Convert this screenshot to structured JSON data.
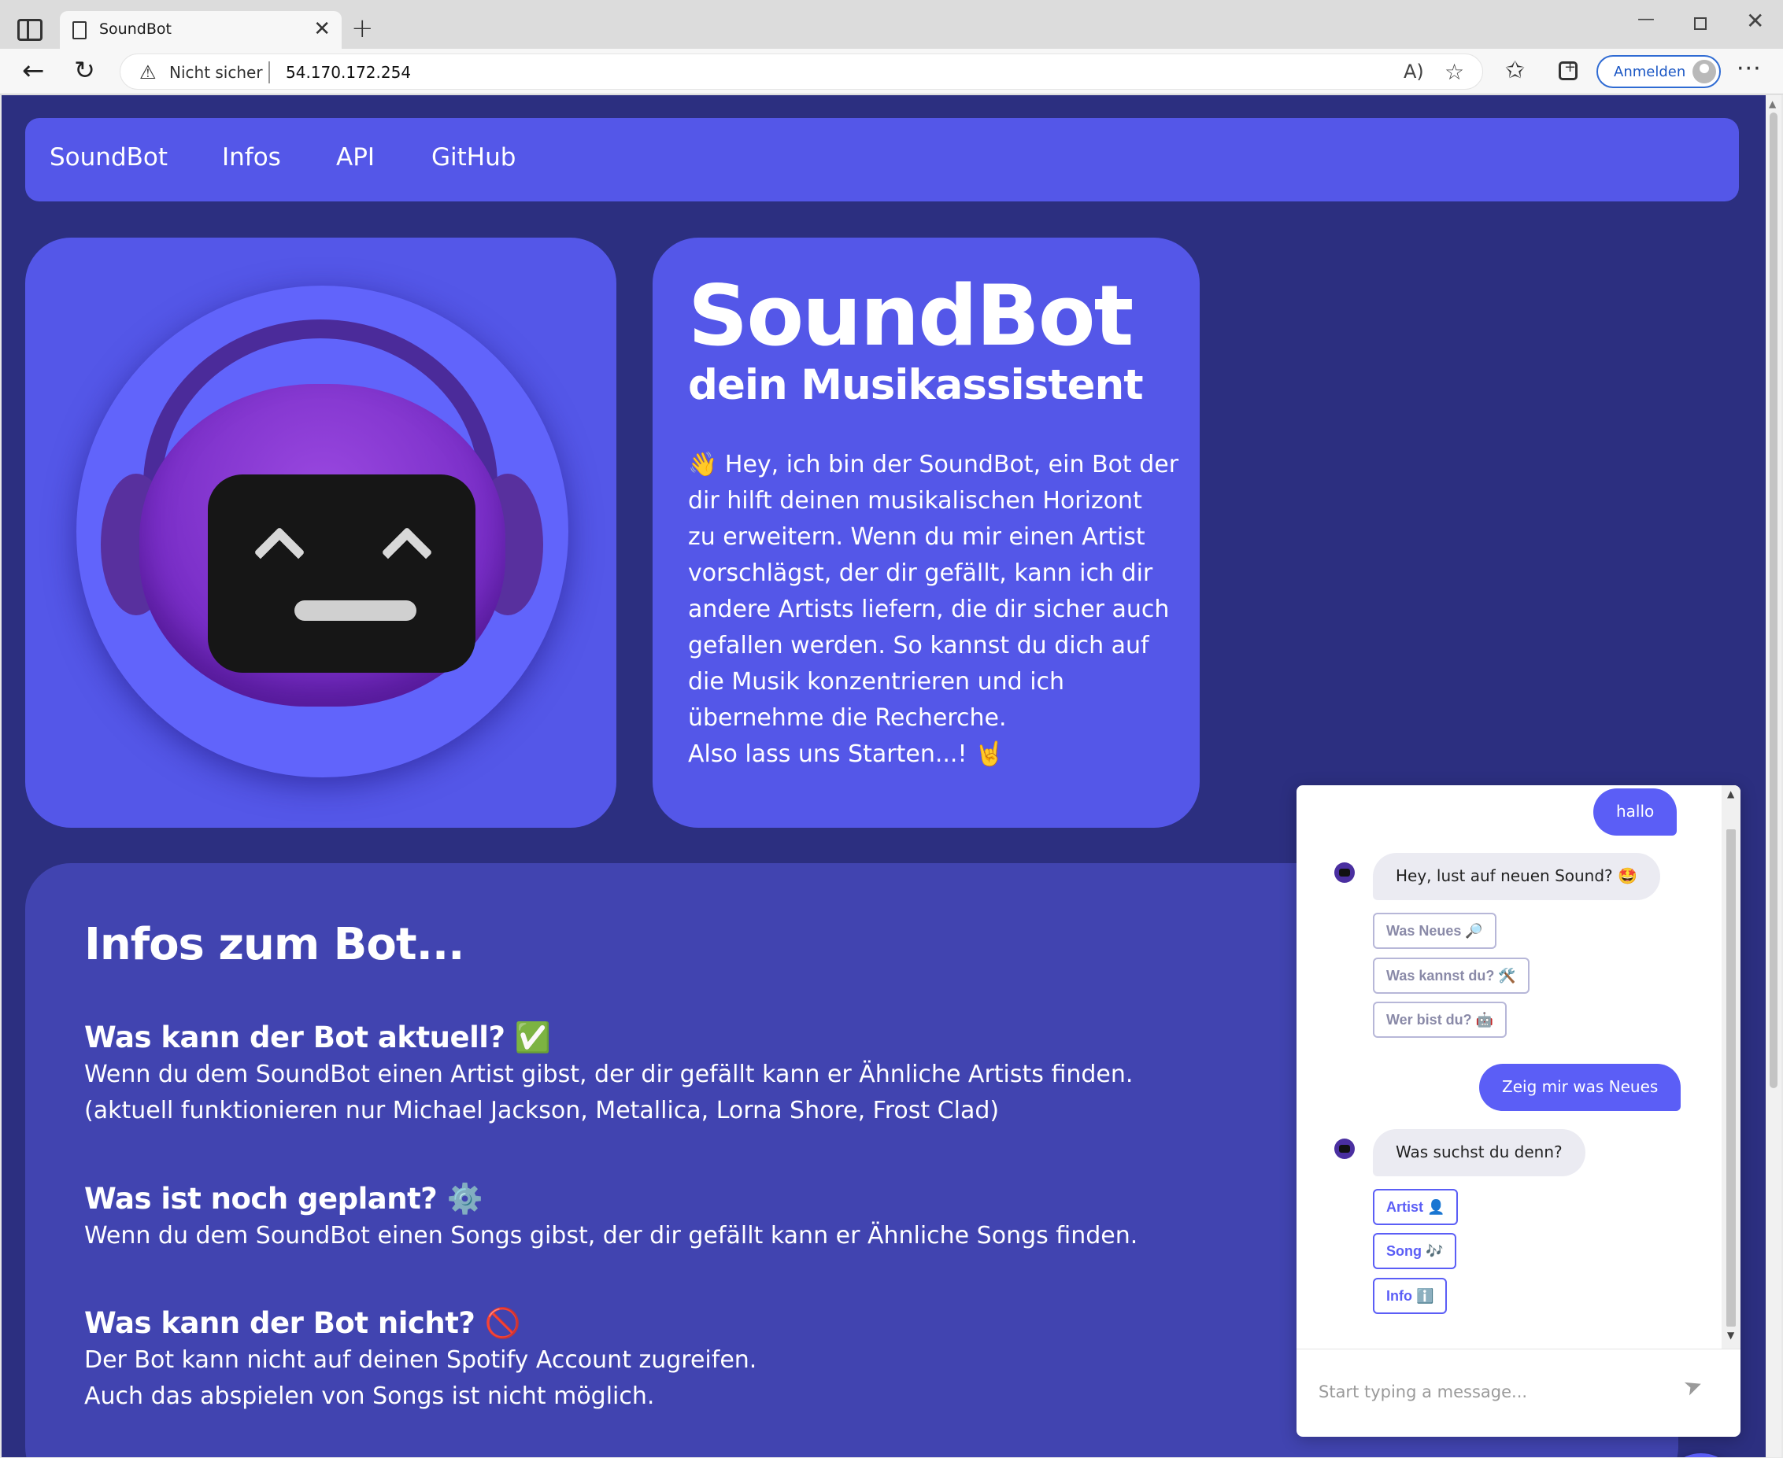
{
  "browser": {
    "tab_title": "SoundBot",
    "security_label": "Nicht sicher",
    "url": "54.170.172.254",
    "signin_label": "Anmelden"
  },
  "icons": {
    "tab_actions": "tab-actions-icon",
    "page": "page-icon",
    "tab_close": "close-icon",
    "new_tab": "plus-icon",
    "back": "arrow-left-icon",
    "reload": "reload-icon",
    "warning": "warning-icon",
    "read_aloud": "read-aloud-icon",
    "add_favorite": "star-plus-icon",
    "favorites": "favorites-icon",
    "collections": "collections-icon",
    "more": "more-icon",
    "send": "send-icon",
    "chat_close": "close-icon",
    "bot_avatar": "bot-avatar-icon"
  },
  "navbar": {
    "items": [
      {
        "label": "SoundBot"
      },
      {
        "label": "Infos"
      },
      {
        "label": "API"
      },
      {
        "label": "GitHub"
      }
    ]
  },
  "hero": {
    "title": "SoundBot",
    "subtitle": "dein Musikassistent",
    "body_lines": [
      "👋 Hey, ich bin der SoundBot, ein Bot der",
      "dir hilft deinen musikalischen Horizont",
      "zu erweitern. Wenn du mir einen Artist",
      "vorschlägst, der dir gefällt, kann ich dir",
      "andere Artists liefern, die dir sicher auch",
      "gefallen werden. So kannst du dich auf",
      "die Musik konzentrieren und ich",
      "übernehme die Recherche.",
      "Also lass uns Starten...! 🤘"
    ]
  },
  "info": {
    "title": "Infos zum Bot...",
    "sections": [
      {
        "heading": "Was kann der Bot aktuell? ✅",
        "lines": [
          "Wenn du dem SoundBot einen Artist gibst, der dir gefällt kann er Ähnliche Artists finden.",
          "(aktuell funktionieren nur Michael Jackson, Metallica, Lorna Shore, Frost Clad)"
        ]
      },
      {
        "heading": "Was ist noch geplant? ⚙️",
        "lines": [
          "Wenn du dem SoundBot einen Songs gibst, der dir gefällt kann er Ähnliche Songs finden."
        ]
      },
      {
        "heading": "Was kann der Bot nicht? 🚫",
        "lines": [
          "Der Bot kann nicht auf deinen Spotify Account zugreifen.",
          "Auch das abspielen von Songs ist nicht möglich."
        ]
      }
    ]
  },
  "chat": {
    "messages": [
      {
        "from": "user",
        "text": "hallo"
      },
      {
        "from": "bot",
        "text": "Hey, lust auf neuen Sound? 🤩"
      },
      {
        "from": "user",
        "text": "Zeig mir was Neues"
      },
      {
        "from": "bot",
        "text": "Was suchst du denn?"
      }
    ],
    "quick_replies_1": [
      "Was Neues 🔎",
      "Was kannst du? 🛠️",
      "Wer bist du? 🤖"
    ],
    "quick_replies_2": [
      "Artist 👤",
      "Song 🎶",
      "Info ℹ️"
    ],
    "input_placeholder": "Start typing a message..."
  }
}
